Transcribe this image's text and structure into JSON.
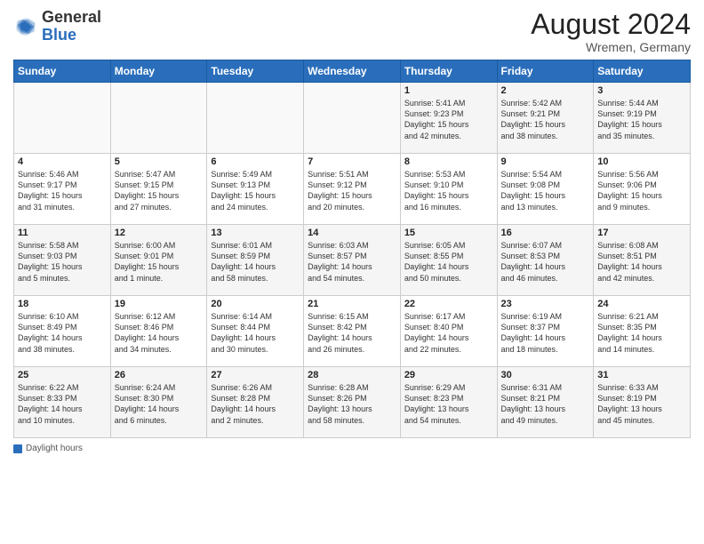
{
  "header": {
    "logo_general": "General",
    "logo_blue": "Blue",
    "month_year": "August 2024",
    "location": "Wremen, Germany"
  },
  "footer": {
    "daylight_label": "Daylight hours"
  },
  "days_of_week": [
    "Sunday",
    "Monday",
    "Tuesday",
    "Wednesday",
    "Thursday",
    "Friday",
    "Saturday"
  ],
  "weeks": [
    [
      {
        "day": "",
        "info": ""
      },
      {
        "day": "",
        "info": ""
      },
      {
        "day": "",
        "info": ""
      },
      {
        "day": "",
        "info": ""
      },
      {
        "day": "1",
        "info": "Sunrise: 5:41 AM\nSunset: 9:23 PM\nDaylight: 15 hours\nand 42 minutes."
      },
      {
        "day": "2",
        "info": "Sunrise: 5:42 AM\nSunset: 9:21 PM\nDaylight: 15 hours\nand 38 minutes."
      },
      {
        "day": "3",
        "info": "Sunrise: 5:44 AM\nSunset: 9:19 PM\nDaylight: 15 hours\nand 35 minutes."
      }
    ],
    [
      {
        "day": "4",
        "info": "Sunrise: 5:46 AM\nSunset: 9:17 PM\nDaylight: 15 hours\nand 31 minutes."
      },
      {
        "day": "5",
        "info": "Sunrise: 5:47 AM\nSunset: 9:15 PM\nDaylight: 15 hours\nand 27 minutes."
      },
      {
        "day": "6",
        "info": "Sunrise: 5:49 AM\nSunset: 9:13 PM\nDaylight: 15 hours\nand 24 minutes."
      },
      {
        "day": "7",
        "info": "Sunrise: 5:51 AM\nSunset: 9:12 PM\nDaylight: 15 hours\nand 20 minutes."
      },
      {
        "day": "8",
        "info": "Sunrise: 5:53 AM\nSunset: 9:10 PM\nDaylight: 15 hours\nand 16 minutes."
      },
      {
        "day": "9",
        "info": "Sunrise: 5:54 AM\nSunset: 9:08 PM\nDaylight: 15 hours\nand 13 minutes."
      },
      {
        "day": "10",
        "info": "Sunrise: 5:56 AM\nSunset: 9:06 PM\nDaylight: 15 hours\nand 9 minutes."
      }
    ],
    [
      {
        "day": "11",
        "info": "Sunrise: 5:58 AM\nSunset: 9:03 PM\nDaylight: 15 hours\nand 5 minutes."
      },
      {
        "day": "12",
        "info": "Sunrise: 6:00 AM\nSunset: 9:01 PM\nDaylight: 15 hours\nand 1 minute."
      },
      {
        "day": "13",
        "info": "Sunrise: 6:01 AM\nSunset: 8:59 PM\nDaylight: 14 hours\nand 58 minutes."
      },
      {
        "day": "14",
        "info": "Sunrise: 6:03 AM\nSunset: 8:57 PM\nDaylight: 14 hours\nand 54 minutes."
      },
      {
        "day": "15",
        "info": "Sunrise: 6:05 AM\nSunset: 8:55 PM\nDaylight: 14 hours\nand 50 minutes."
      },
      {
        "day": "16",
        "info": "Sunrise: 6:07 AM\nSunset: 8:53 PM\nDaylight: 14 hours\nand 46 minutes."
      },
      {
        "day": "17",
        "info": "Sunrise: 6:08 AM\nSunset: 8:51 PM\nDaylight: 14 hours\nand 42 minutes."
      }
    ],
    [
      {
        "day": "18",
        "info": "Sunrise: 6:10 AM\nSunset: 8:49 PM\nDaylight: 14 hours\nand 38 minutes."
      },
      {
        "day": "19",
        "info": "Sunrise: 6:12 AM\nSunset: 8:46 PM\nDaylight: 14 hours\nand 34 minutes."
      },
      {
        "day": "20",
        "info": "Sunrise: 6:14 AM\nSunset: 8:44 PM\nDaylight: 14 hours\nand 30 minutes."
      },
      {
        "day": "21",
        "info": "Sunrise: 6:15 AM\nSunset: 8:42 PM\nDaylight: 14 hours\nand 26 minutes."
      },
      {
        "day": "22",
        "info": "Sunrise: 6:17 AM\nSunset: 8:40 PM\nDaylight: 14 hours\nand 22 minutes."
      },
      {
        "day": "23",
        "info": "Sunrise: 6:19 AM\nSunset: 8:37 PM\nDaylight: 14 hours\nand 18 minutes."
      },
      {
        "day": "24",
        "info": "Sunrise: 6:21 AM\nSunset: 8:35 PM\nDaylight: 14 hours\nand 14 minutes."
      }
    ],
    [
      {
        "day": "25",
        "info": "Sunrise: 6:22 AM\nSunset: 8:33 PM\nDaylight: 14 hours\nand 10 minutes."
      },
      {
        "day": "26",
        "info": "Sunrise: 6:24 AM\nSunset: 8:30 PM\nDaylight: 14 hours\nand 6 minutes."
      },
      {
        "day": "27",
        "info": "Sunrise: 6:26 AM\nSunset: 8:28 PM\nDaylight: 14 hours\nand 2 minutes."
      },
      {
        "day": "28",
        "info": "Sunrise: 6:28 AM\nSunset: 8:26 PM\nDaylight: 13 hours\nand 58 minutes."
      },
      {
        "day": "29",
        "info": "Sunrise: 6:29 AM\nSunset: 8:23 PM\nDaylight: 13 hours\nand 54 minutes."
      },
      {
        "day": "30",
        "info": "Sunrise: 6:31 AM\nSunset: 8:21 PM\nDaylight: 13 hours\nand 49 minutes."
      },
      {
        "day": "31",
        "info": "Sunrise: 6:33 AM\nSunset: 8:19 PM\nDaylight: 13 hours\nand 45 minutes."
      }
    ]
  ]
}
